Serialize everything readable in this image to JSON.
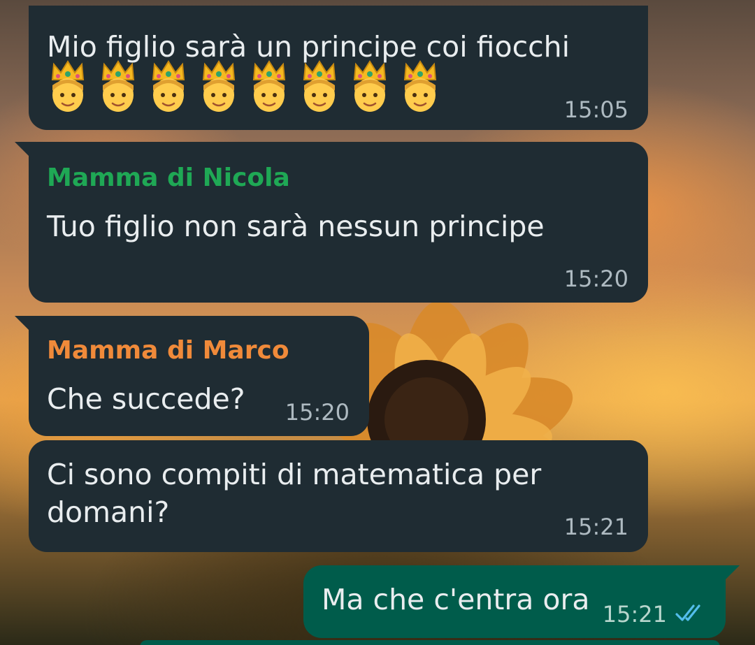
{
  "messages": [
    {
      "text": "Mio figlio sarà un principe coi fiocchi",
      "emoji": "prince-with-crown",
      "emoji_count": 8,
      "time": "15:05"
    },
    {
      "sender": "Mamma di Nicola",
      "sender_color": "#1fa855",
      "text": "Tuo figlio non sarà nessun principe",
      "time": "15:20"
    },
    {
      "sender": "Mamma di Marco",
      "sender_color": "#f08a3a",
      "text": "Che succede?",
      "time": "15:20"
    },
    {
      "text": "Ci sono compiti di matematica per\ndomani?",
      "time": "15:21"
    },
    {
      "text": "Ma che c'entra ora",
      "time": "15:21",
      "outgoing": true,
      "status": "read"
    }
  ],
  "colors": {
    "incoming_bubble": "#1f2c33",
    "outgoing_bubble": "#005c4b",
    "read_ticks": "#53bdeb"
  }
}
